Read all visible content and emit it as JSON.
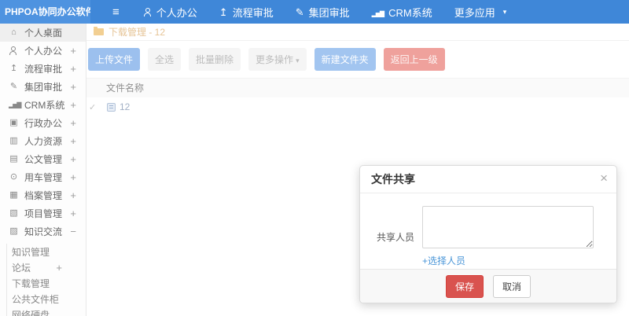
{
  "colors": {
    "accent": "#3f87d8",
    "accent_light": "#4e93e0",
    "danger": "#d9534f",
    "link": "#4a96d8",
    "warning_text": "#e6c496"
  },
  "app": {
    "logo": "PHPOA协同办公软件"
  },
  "navbar": {
    "menu_icon": "menu",
    "items": [
      {
        "icon": "user",
        "label": "个人办公"
      },
      {
        "icon": "flow",
        "label": "流程审批"
      },
      {
        "icon": "edit",
        "label": "集团审批"
      },
      {
        "icon": "chart",
        "label": "CRM系统"
      },
      {
        "icon": "none",
        "label": "更多应用",
        "caret": true
      }
    ]
  },
  "sidebar": {
    "items": [
      {
        "icon": "home",
        "label": "个人桌面",
        "active": true
      },
      {
        "icon": "user",
        "label": "个人办公",
        "expand": "+"
      },
      {
        "icon": "flow",
        "label": "流程审批",
        "expand": "+"
      },
      {
        "icon": "edit",
        "label": "集团审批",
        "expand": "+"
      },
      {
        "icon": "chart",
        "label": "CRM系统",
        "expand": "+"
      },
      {
        "icon": "admin",
        "label": "行政办公",
        "expand": "+"
      },
      {
        "icon": "hr",
        "label": "人力资源",
        "expand": "+"
      },
      {
        "icon": "doc",
        "label": "公文管理",
        "expand": "+"
      },
      {
        "icon": "car",
        "label": "用车管理",
        "expand": "+"
      },
      {
        "icon": "archive",
        "label": "档案管理",
        "expand": "+"
      },
      {
        "icon": "project",
        "label": "项目管理",
        "expand": "+"
      },
      {
        "icon": "knowledge",
        "label": "知识交流",
        "expand": "−",
        "children": [
          {
            "label": "知识管理"
          },
          {
            "label": "论坛",
            "expand": "+"
          },
          {
            "label": "下载管理"
          },
          {
            "label": "公共文件柜"
          },
          {
            "label": "网络硬盘"
          }
        ]
      }
    ]
  },
  "breadcrumb": {
    "icon": "folder",
    "text": "下载管理 - 12"
  },
  "toolbar": {
    "buttons": [
      {
        "label": "上传文件",
        "style": "primary"
      },
      {
        "label": "全选",
        "style": "default"
      },
      {
        "label": "批量删除",
        "style": "default"
      },
      {
        "label": "更多操作",
        "style": "default",
        "caret": true
      },
      {
        "label": "新建文件夹",
        "style": "primary2"
      },
      {
        "label": "返回上一级",
        "style": "danger"
      }
    ]
  },
  "table": {
    "header": "文件名称",
    "rows": [
      {
        "checked": true,
        "check_glyph": "✓",
        "icon": "file",
        "name": "12"
      }
    ]
  },
  "modal": {
    "title": "文件共享",
    "close_glyph": "×",
    "field_label": "共享人员",
    "textarea_value": "",
    "pick_link": "+选择人员",
    "save_label": "保存",
    "cancel_label": "取消"
  }
}
